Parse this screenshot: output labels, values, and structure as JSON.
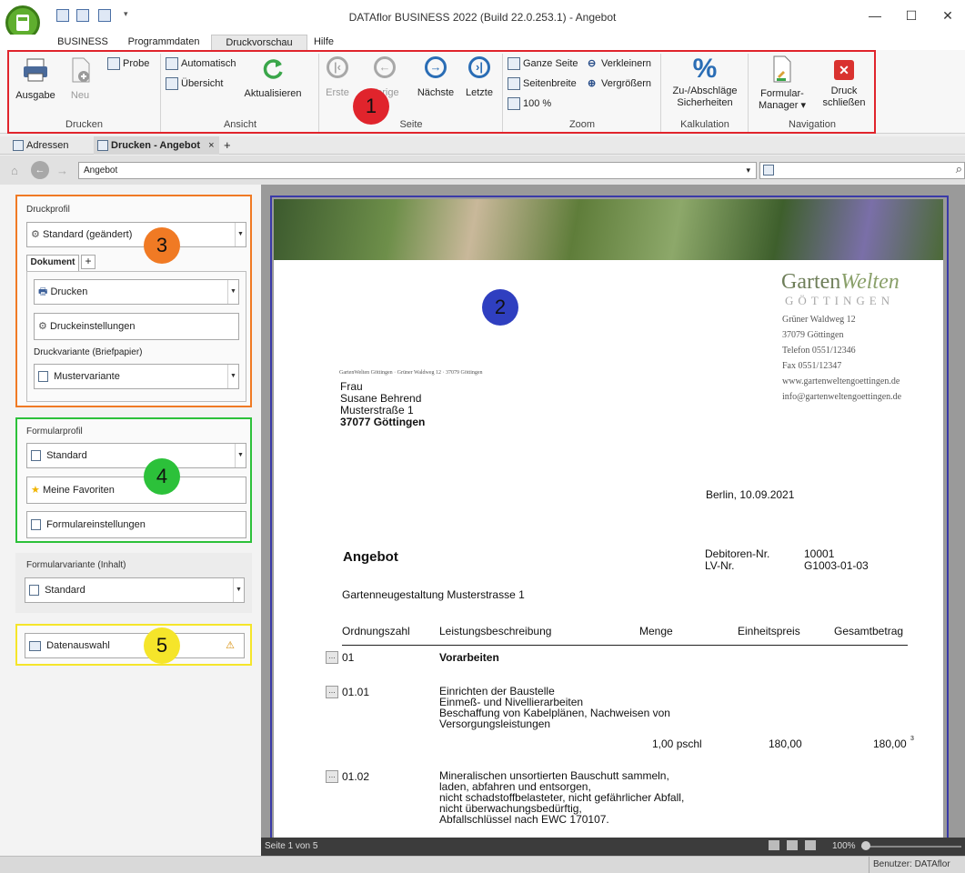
{
  "window": {
    "title": "DATAflor BUSINESS 2022 (Build 22.0.253.1) - Angebot",
    "minimize": "—",
    "maximize": "☐",
    "close": "✕"
  },
  "menu": [
    "BUSINESS",
    "Programmdaten",
    "Druckvorschau",
    "Hilfe"
  ],
  "ribbon": {
    "drucken": {
      "label": "Drucken",
      "ausgabe": "Ausgabe",
      "neu": "Neu",
      "probe": "Probe"
    },
    "ansicht": {
      "label": "Ansicht",
      "automatisch": "Automatisch",
      "uebersicht": "Übersicht",
      "aktualisieren": "Aktualisieren"
    },
    "seite": {
      "label": "Seite",
      "erste": "Erste",
      "vorige": "Vorige",
      "naechste": "Nächste",
      "letzte": "Letzte"
    },
    "zoom": {
      "label": "Zoom",
      "ganze_seite": "Ganze Seite",
      "seitenbreite": "Seitenbreite",
      "hundert": "100 %",
      "verkleinern": "Verkleinern",
      "vergroessern": "Vergrößern"
    },
    "kalkulation": {
      "label": "Kalkulation",
      "line1": "Zu-/Abschläge",
      "line2": "Sicherheiten"
    },
    "navigation": {
      "label": "Navigation",
      "formular_line1": "Formular-",
      "formular_line2": "Manager ▾",
      "druck_line1": "Druck",
      "druck_line2": "schließen"
    }
  },
  "badges": {
    "b1": "1",
    "b2": "2",
    "b3": "3",
    "b4": "4",
    "b5": "5"
  },
  "colors": {
    "badge1": "#e0242c",
    "badge2": "#2f3fc0",
    "badge3": "#f07a24",
    "badge4": "#2cc13a",
    "badge5": "#f5e52a",
    "ribbon_highlight": "#e0242c"
  },
  "tabs": {
    "adressen": "Adressen",
    "active": "Drucken - Angebot",
    "close": "×",
    "add": "+"
  },
  "address": {
    "value": "Angebot",
    "dropdown": "▾"
  },
  "left": {
    "druckprofil": {
      "title": "Druckprofil",
      "profile": "Standard (geändert)",
      "tab": "Dokument",
      "tab_add": "+",
      "drucken": "Drucken",
      "druckeinstellungen": "Druckeinstellungen",
      "variante_title": "Druckvariante (Briefpapier)",
      "variante": "Mustervariante"
    },
    "formularprofil": {
      "title": "Formularprofil",
      "profile": "Standard",
      "favoriten": "Meine Favoriten",
      "einstellungen": "Formulareinstellungen"
    },
    "formularvariante": {
      "title": "Formularvariante (Inhalt)",
      "value": "Standard"
    },
    "datenauswahl": {
      "label": "Datenauswahl",
      "warning": "⚠"
    }
  },
  "document": {
    "logo_main": "Garten",
    "logo_italic": "Welten",
    "logo_sub": "GÖTTINGEN",
    "company_address": [
      "Grüner Waldweg 12",
      "37079 Göttingen",
      "Telefon 0551/12346",
      "Fax 0551/12347",
      "www.gartenweltengoettingen.de",
      "info@gartenweltengoettingen.de"
    ],
    "sender_line": "GartenWelten Göttingen · Grüner Waldweg 12 · 37079 Göttingen",
    "recipient": [
      "Frau",
      "Susane Behrend",
      "Musterstraße 1",
      "37077 Göttingen"
    ],
    "date": "Berlin, 10.09.2021",
    "heading": "Angebot",
    "debitor_label": "Debitoren-Nr.",
    "debitor_value": "10001",
    "lv_label": "LV-Nr.",
    "lv_value": "G1003-01-03",
    "subject": "Gartenneugestaltung Musterstrasse 1",
    "columns": [
      "Ordnungszahl",
      "Leistungsbeschreibung",
      "Menge",
      "Einheitspreis",
      "Gesamtbetrag"
    ],
    "chip": "…",
    "rows": [
      {
        "oz": "01",
        "text": [
          "Vorarbeiten"
        ],
        "bold": true
      },
      {
        "oz": "01.01",
        "text": [
          "Einrichten der Baustelle",
          "Einmeß- und Nivellierarbeiten",
          "Beschaffung von Kabelplänen, Nachweisen von",
          "Versorgungsleistungen"
        ],
        "menge": "1,00 pschl",
        "ep": "180,00",
        "gp": "180,00",
        "note": "3"
      },
      {
        "oz": "01.02",
        "text": [
          "Mineralischen unsortierten Bauschutt sammeln,",
          "laden, abfahren und entsorgen,",
          "nicht schadstoffbelasteter, nicht gefährlicher Abfall,",
          "nicht überwachungsbedürftig,",
          "Abfallschlüssel nach EWC 170107."
        ]
      }
    ]
  },
  "preview_status": {
    "page": "Seite 1 von 5",
    "zoom": "100%"
  },
  "statusbar": {
    "user": "Benutzer: DATAflor"
  }
}
